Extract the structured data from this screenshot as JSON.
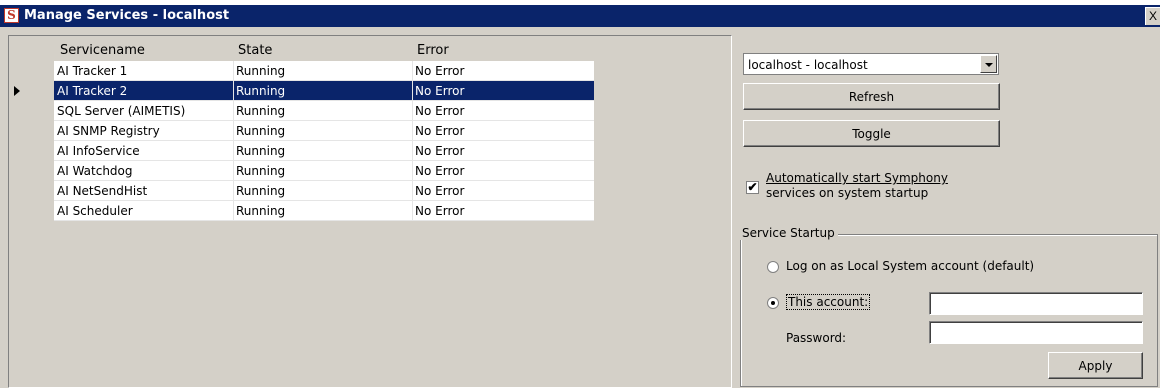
{
  "window": {
    "title": "Manage Services - localhost",
    "icon_letter": "S",
    "close_label": "X"
  },
  "grid": {
    "columns": [
      "Servicename",
      "State",
      "Error"
    ],
    "selected_index": 1,
    "rows": [
      {
        "name": "AI Tracker 1",
        "state": "Running",
        "error": "No Error"
      },
      {
        "name": "AI Tracker 2",
        "state": "Running",
        "error": "No Error"
      },
      {
        "name": "SQL Server (AIMETIS)",
        "state": "Running",
        "error": "No Error"
      },
      {
        "name": "AI SNMP Registry",
        "state": "Running",
        "error": "No Error"
      },
      {
        "name": "AI InfoService",
        "state": "Running",
        "error": "No Error"
      },
      {
        "name": "AI Watchdog",
        "state": "Running",
        "error": "No Error"
      },
      {
        "name": "AI NetSendHist",
        "state": "Running",
        "error": "No Error"
      },
      {
        "name": "AI Scheduler",
        "state": "Running",
        "error": "No Error"
      }
    ]
  },
  "controls": {
    "server_select_value": "localhost - localhost",
    "refresh_label": "Refresh",
    "toggle_label": "Toggle",
    "autostart_checked": true,
    "autostart_label_line1": "Automatically start Symphony",
    "autostart_label_line2": "services on system startup"
  },
  "service_startup": {
    "group_title": "Service Startup",
    "local_system_label": "Log on as Local System account (default)",
    "this_account_label": "This account:",
    "password_label": "Password:",
    "account_value": "",
    "password_value": "",
    "selected_option": "this_account",
    "apply_label": "Apply"
  }
}
